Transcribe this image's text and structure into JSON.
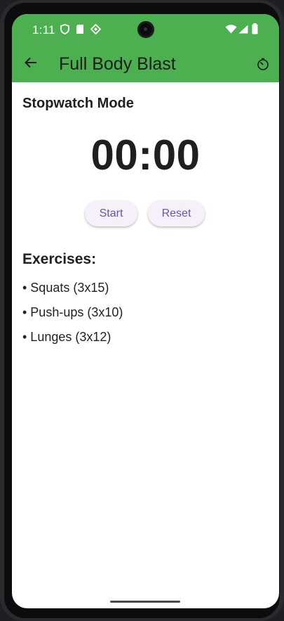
{
  "status_bar": {
    "time": "1:11",
    "left_icons": [
      "shield-icon",
      "sd-card-icon",
      "diamond-icon"
    ],
    "right_icons": [
      "wifi-icon",
      "signal-icon",
      "battery-icon"
    ],
    "color": "#4caf50"
  },
  "app_bar": {
    "title": "Full Body Blast",
    "back_icon": "arrow-left-icon",
    "action_icon": "timer-icon",
    "color": "#4caf50"
  },
  "stopwatch": {
    "mode_title": "Stopwatch Mode",
    "display": "00:00",
    "start_label": "Start",
    "reset_label": "Reset",
    "button_text_color": "#6b53a8"
  },
  "exercises": {
    "heading": "Exercises:",
    "items": [
      "• Squats (3x15)",
      "• Push-ups (3x10)",
      "• Lunges (3x12)"
    ]
  }
}
